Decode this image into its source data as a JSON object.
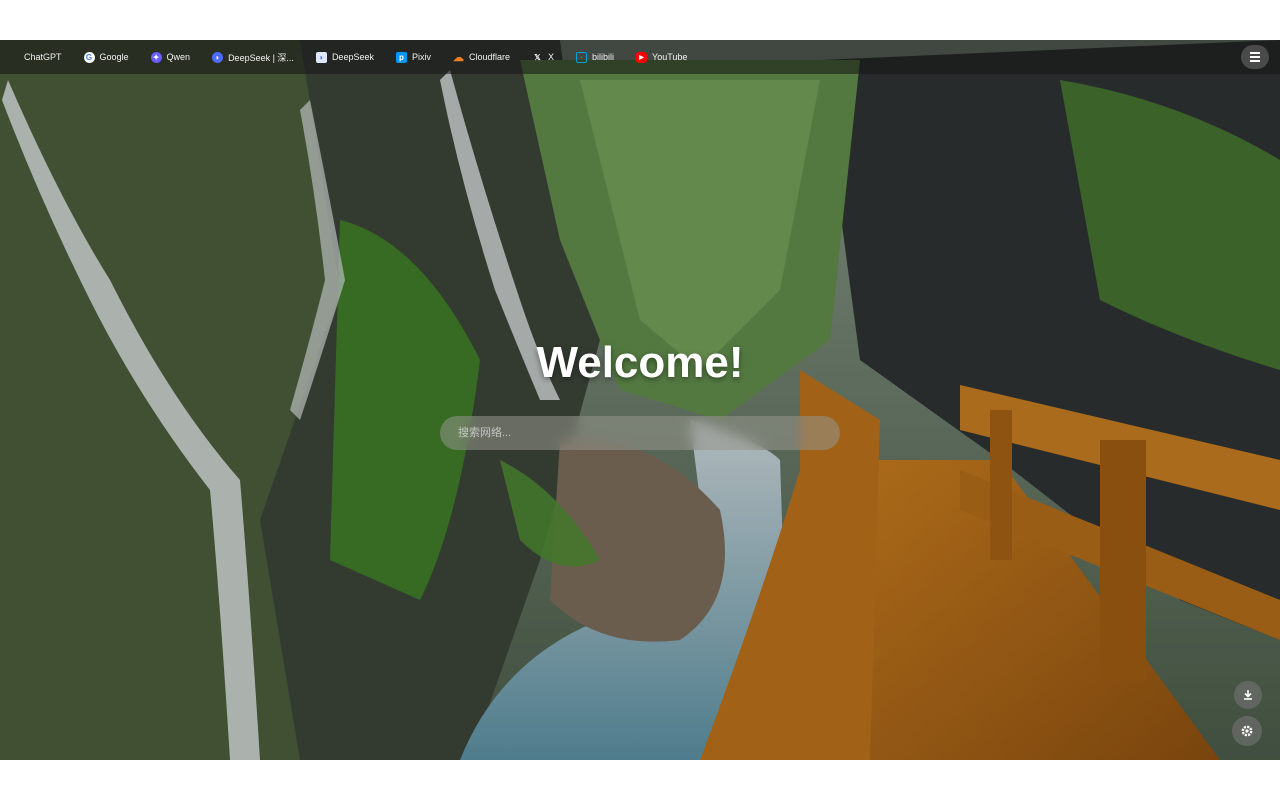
{
  "bookmarks": [
    {
      "label": "ChatGPT",
      "icon": "none"
    },
    {
      "label": "Google",
      "icon": "google-icon",
      "color": "#4285F4"
    },
    {
      "label": "Qwen",
      "icon": "qwen-icon",
      "color": "#6b5cff"
    },
    {
      "label": "DeepSeek | 深...",
      "icon": "deepseek-whale-icon",
      "color": "#4d6bfe"
    },
    {
      "label": "DeepSeek",
      "icon": "deepseek-icon",
      "color": "#4d6bfe"
    },
    {
      "label": "Pixiv",
      "icon": "pixiv-icon",
      "color": "#0096fa"
    },
    {
      "label": "Cloudflare",
      "icon": "cloudflare-icon",
      "color": "#f38020"
    },
    {
      "label": "X",
      "icon": "x-icon",
      "color": "#000000"
    },
    {
      "label": "bilibili",
      "icon": "bilibili-icon",
      "color": "#00a1d6"
    },
    {
      "label": "YouTube",
      "icon": "youtube-icon",
      "color": "#ff0000"
    }
  ],
  "welcome": "Welcome!",
  "search": {
    "placeholder": "搜索网络..."
  },
  "icons": {
    "menu": "hamburger-menu-icon",
    "download": "download-icon",
    "settings": "gear-icon"
  }
}
